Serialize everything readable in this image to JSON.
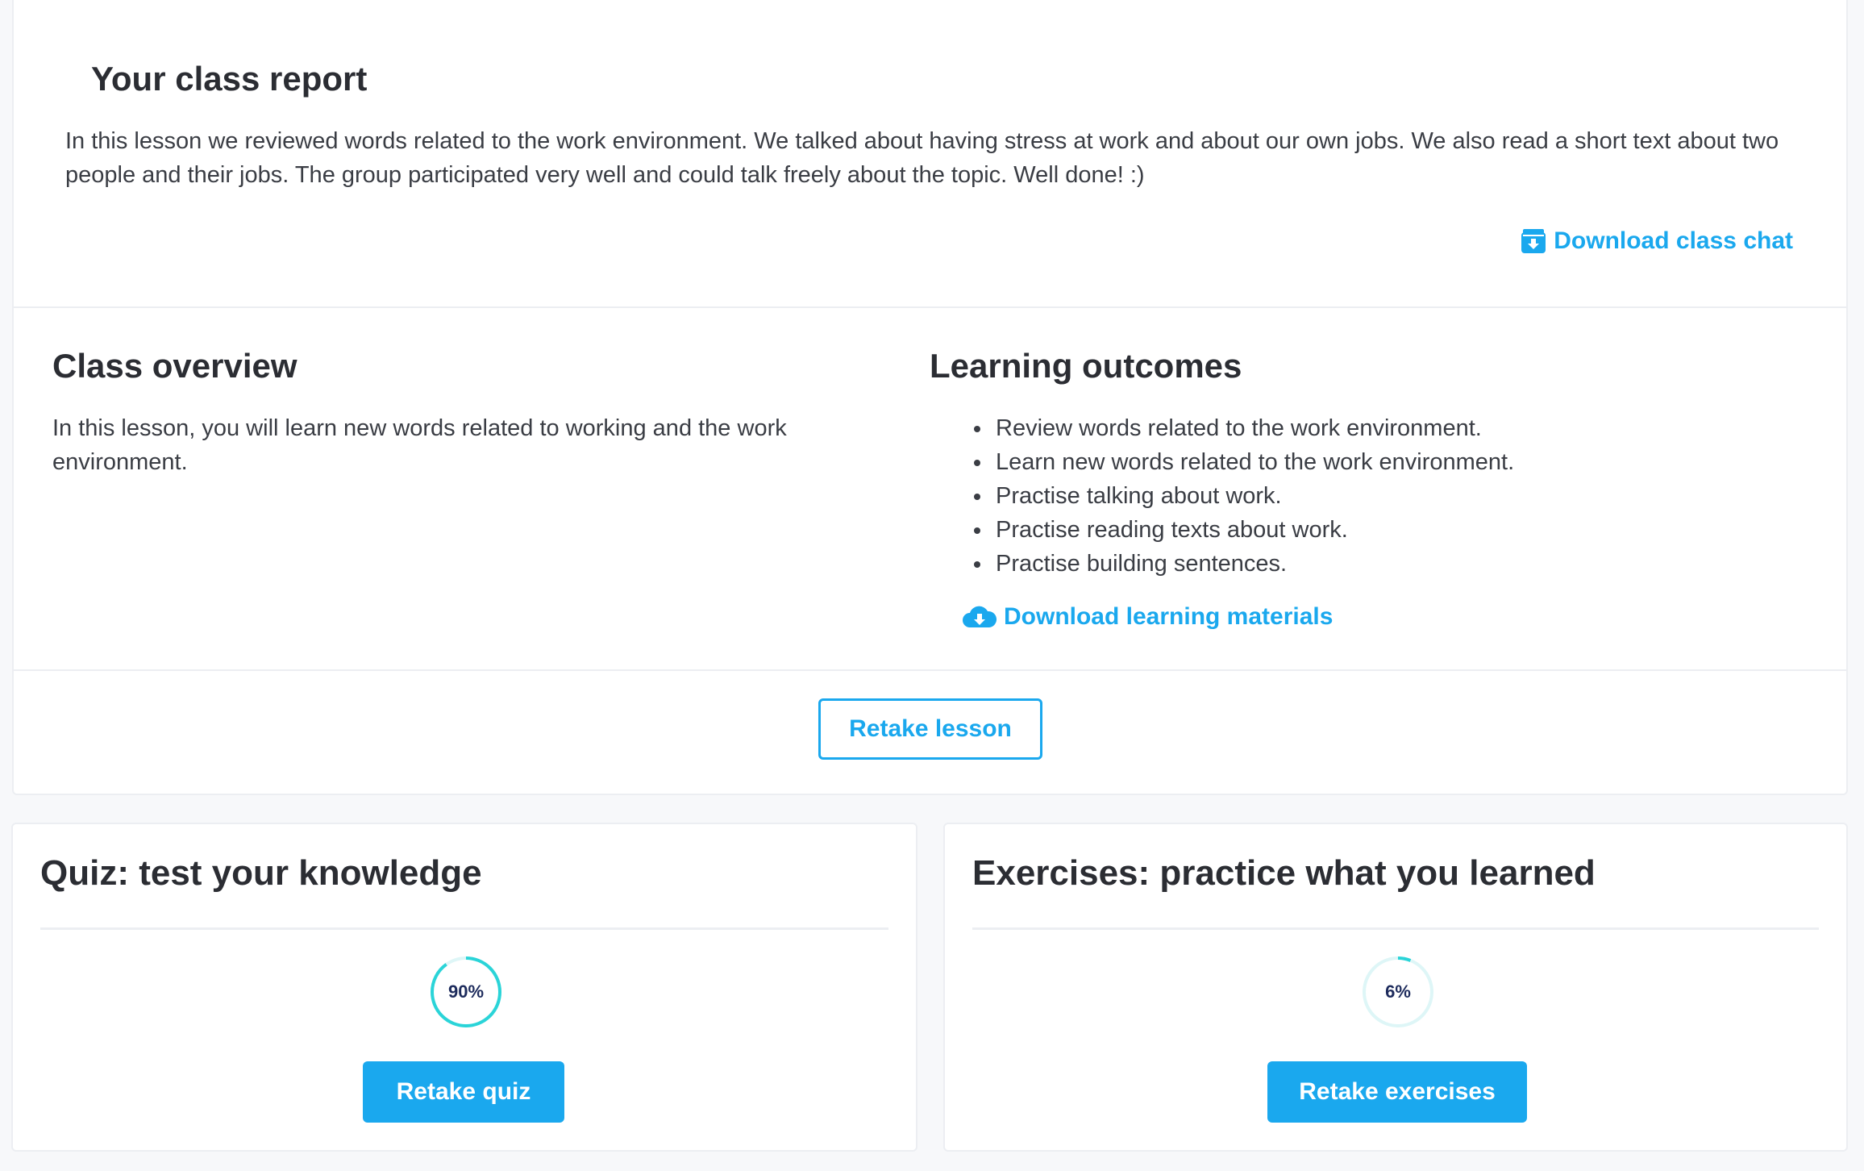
{
  "report": {
    "title": "Your class report",
    "text": "In this lesson we reviewed words related to the work environment. We talked about having stress at work and about our own jobs. We also read a short text about two people and their jobs. The group participated very well and could talk freely about the topic. Well done! :)",
    "download_chat_label": "Download class chat"
  },
  "overview": {
    "title": "Class overview",
    "text": "In this lesson, you will learn new words related to working and the work environment."
  },
  "outcomes": {
    "title": "Learning outcomes",
    "items": [
      "Review words related to the work environment.",
      "Learn new words related to the work environment.",
      "Practise talking about work.",
      "Practise reading texts about work.",
      "Practise building sentences."
    ],
    "download_materials_label": "Download learning materials"
  },
  "retake_lesson_label": "Retake lesson",
  "quiz": {
    "title": "Quiz: test your knowledge",
    "percent_label": "90%",
    "progress": 0.9,
    "button_label": "Retake quiz"
  },
  "exercises": {
    "title": "Exercises: practice what you learned",
    "percent_label": "6%",
    "progress": 0.06,
    "button_label": "Retake exercises"
  },
  "colors": {
    "accent": "#1aa8ee",
    "ring": "#2ad4d8",
    "ring_track": "#def6f7",
    "percent_text": "#1d2b5c"
  }
}
